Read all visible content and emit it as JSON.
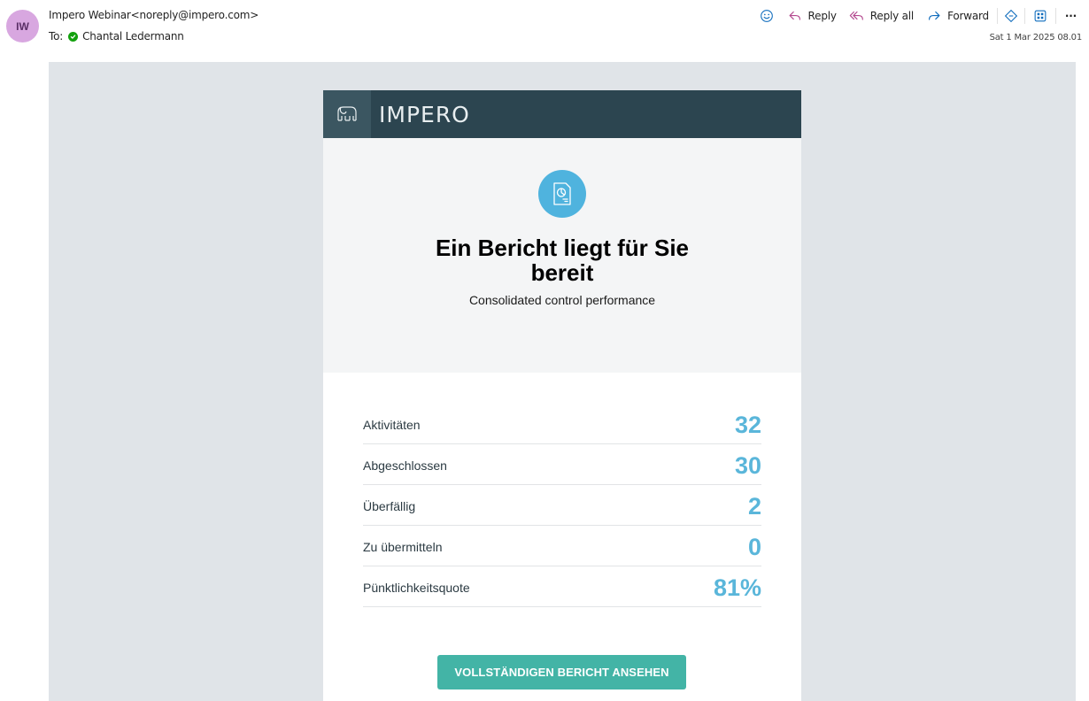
{
  "header": {
    "avatar_initials": "IW",
    "from": "Impero Webinar<noreply@impero.com>",
    "to_label": "To:",
    "recipient": "Chantal Ledermann",
    "date": "Sat 1 Mar 2025 08.01"
  },
  "toolbar": {
    "reply_label": "Reply",
    "reply_all_label": "Reply all",
    "forward_label": "Forward",
    "more_label": "···"
  },
  "email": {
    "brand_name": "IMPERO",
    "title": "Ein Bericht liegt für Sie bereit",
    "subtitle": "Consolidated control performance",
    "stats": [
      {
        "label": "Aktivitäten",
        "value": "32"
      },
      {
        "label": "Abgeschlossen",
        "value": "30"
      },
      {
        "label": "Überfällig",
        "value": "2"
      },
      {
        "label": "Zu übermitteln",
        "value": "0"
      },
      {
        "label": "Pünktlichkeitsquote",
        "value": "81%"
      }
    ],
    "cta_label": "VOLLSTÄNDIGEN BERICHT ANSEHEN"
  },
  "colors": {
    "brand_bar": "#2c4550",
    "accent_value": "#5ab6da",
    "cta": "#43b4a6",
    "reply_icon": "#b4498f",
    "toolbar_icon": "#0f6cbd"
  },
  "icons": {
    "emoji": "smiley-icon",
    "reply": "reply-arrow-icon",
    "reply_all": "reply-all-arrow-icon",
    "forward": "forward-arrow-icon",
    "immersive_reader": "diamond-tag-icon",
    "apps": "apps-grid-icon",
    "brand": "elephant-logo-icon",
    "report": "report-chart-icon",
    "presence": "available-check-icon"
  }
}
